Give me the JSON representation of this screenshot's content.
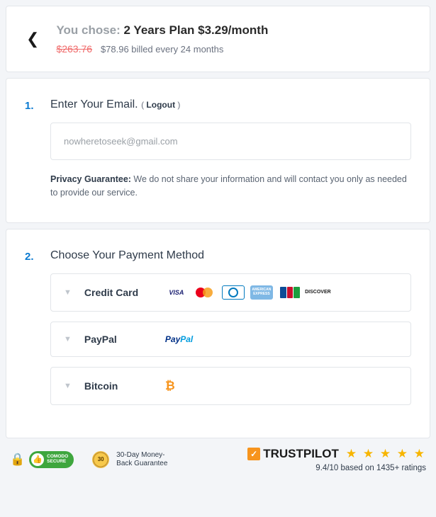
{
  "plan": {
    "you_chose_label": "You chose:",
    "name": "2 Years Plan $3.29/month",
    "strike_price": "$263.76",
    "billed_text": "$78.96 billed every 24 months"
  },
  "step1": {
    "number": "1.",
    "title": "Enter Your Email.",
    "logout_open": "( ",
    "logout_label": "Logout",
    "logout_close": " )",
    "email_value": "nowheretoseek@gmail.com",
    "privacy_label": "Privacy Guarantee:",
    "privacy_text": " We do not share your information and will contact you only as needed to provide our service."
  },
  "step2": {
    "number": "2.",
    "title": "Choose Your Payment Method",
    "options": {
      "credit_card": "Credit Card",
      "paypal": "PayPal",
      "bitcoin": "Bitcoin"
    },
    "paypal_brand_p1": "Pay",
    "paypal_brand_p2": "Pal",
    "bitcoin_symbol": "₿",
    "visa": "VISA",
    "amex": "AMERICAN EXPRESS",
    "discover": "DISCOVER"
  },
  "footer": {
    "comodo_line1": "COMODO",
    "comodo_line2": "SECURE",
    "thirty": "30",
    "guarantee": "30-Day Money-Back Guarantee",
    "trustpilot": "TRUSTPILOT",
    "stars": "★ ★ ★ ★ ★",
    "rating_text": "9.4/10 based on 1435+ ratings"
  }
}
